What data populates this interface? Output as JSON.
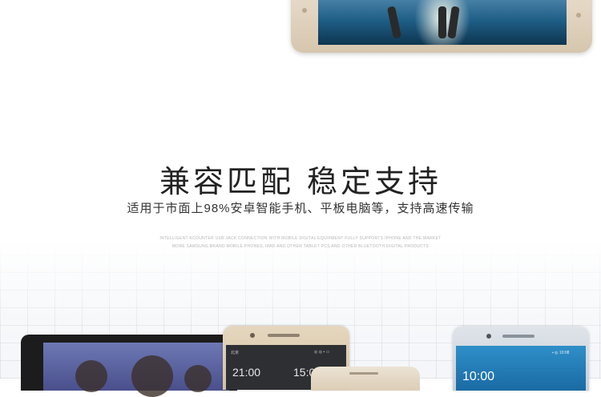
{
  "headline": "兼容匹配 稳定支持",
  "subheadline": "适用于市面上98%安卓智能手机、平板电脑等，支持高速传输",
  "fine_print": {
    "line1": "INTELLIGENT KCOUNTER USB JACK CONNECTION WITH MOBILE DIGITAL EQUIPMENT FULLY SUPPORTS IPHONE AND THE MARKET",
    "line2": "MORE SAMSUNG BRAND MOBILE PHONES, IPAD AND OTHER TABLET PCS AND OTHER BLUETOOTH DIGITAL PRODUCTS"
  },
  "devices": {
    "gold_phone": {
      "clock_left": "21:00",
      "clock_right": "15:00",
      "label_left": "北京",
      "status": "◎ ◎ ▪ ▭"
    },
    "silver_phone": {
      "clock": "10:00",
      "status": "▪ ◎ 10:08"
    }
  }
}
